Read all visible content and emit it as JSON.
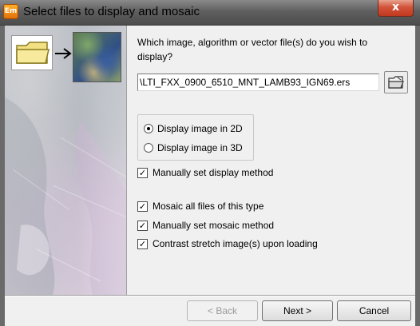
{
  "window": {
    "title": "Select files to display and mosaic",
    "app_icon_text": "Em",
    "close_label": "x"
  },
  "question": "Which image, algorithm or vector file(s) do you wish to display?",
  "file_input": {
    "value": "\\LTI_FXX_0900_6510_MNT_LAMB93_IGN69.ers"
  },
  "display_options": [
    {
      "label": "Display image in 2D",
      "selected": true
    },
    {
      "label": "Display image in 3D",
      "selected": false
    }
  ],
  "checkboxes": {
    "manual_display": {
      "label": "Manually set display method",
      "checked": true
    },
    "mosaic_all": {
      "label": "Mosaic all files of this type",
      "checked": true
    },
    "manual_mosaic": {
      "label": "Manually set mosaic method",
      "checked": true
    },
    "contrast_stretch": {
      "label": "Contrast stretch image(s) upon loading",
      "checked": true
    }
  },
  "buttons": {
    "back": "< Back",
    "next": "Next >",
    "cancel": "Cancel"
  },
  "icons": {
    "folder": "folder-icon",
    "arrow": "arrow-right-icon",
    "map": "map-thumbnail-icon",
    "browse": "open-folder-icon"
  }
}
